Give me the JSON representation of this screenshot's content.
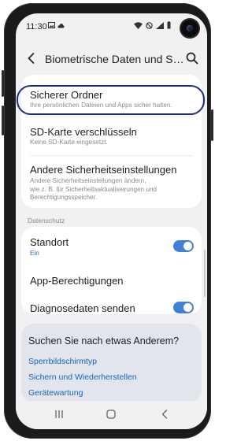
{
  "status": {
    "time": "11:30"
  },
  "header": {
    "title": "Biometrische Daten und Sich…"
  },
  "items": [
    {
      "title": "Sicherer Ordner",
      "sub": "Ihre persönlichen Dateien und Apps sicher halten."
    },
    {
      "title": "SD-Karte verschlüsseln",
      "sub": "Keine SD-Karte eingesetzt."
    },
    {
      "title": "Andere Sicherheitseinstellungen",
      "sub_lines": [
        "Andere Sicherheitseinstellungen ändern,",
        "wie z. B. für Sicherheitsaktualisierungen und",
        "Berechtigungsspeicher."
      ]
    }
  ],
  "privacy": {
    "section_label": "Datenschutz",
    "location": {
      "title": "Standort",
      "status": "Ein",
      "enabled": true
    },
    "app_permissions": {
      "title": "App-Berechtigungen"
    },
    "diagnostics": {
      "title": "Diagnosedaten senden",
      "enabled": true
    }
  },
  "suggestions": {
    "title": "Suchen Sie nach etwas Anderem?",
    "links": [
      "Sperrbildschirmtyp",
      "Sichern und Wiederherstellen",
      "Gerätewartung"
    ]
  },
  "colors": {
    "accent": "#3e82d8",
    "highlight_border": "#1e2b7a",
    "link": "#1b62b5"
  },
  "icons": [
    "back-arrow-icon",
    "search-icon",
    "recents-icon",
    "home-icon",
    "back-nav-icon"
  ]
}
